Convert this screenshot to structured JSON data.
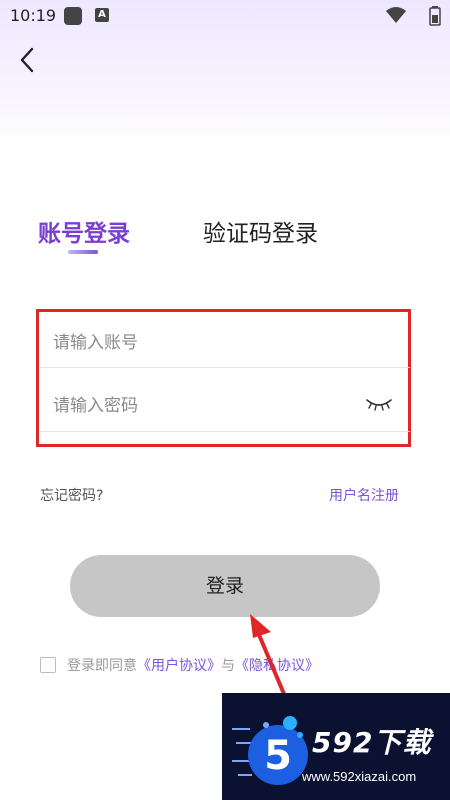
{
  "status_bar": {
    "time": "10:19",
    "icons": [
      "app-icon",
      "font-app-icon",
      "wifi-icon",
      "battery-icon"
    ]
  },
  "nav": {
    "back_icon": "chevron-left-icon"
  },
  "tabs": [
    {
      "label": "账号登录",
      "active": true
    },
    {
      "label": "验证码登录",
      "active": false
    }
  ],
  "form": {
    "account_placeholder": "请输入账号",
    "account_value": "",
    "password_placeholder": "请输入密码",
    "password_value": "",
    "password_toggle_icon": "eye-closed-icon"
  },
  "links": {
    "forgot_password": "忘记密码?",
    "register": "用户名注册"
  },
  "login_button": {
    "label": "登录"
  },
  "agreement": {
    "checked": false,
    "prefix": "登录即同意",
    "user_agreement": "《用户协议》",
    "connector": "与",
    "privacy_policy": "《隐私协议》"
  },
  "watermark": {
    "logo_digit": "5",
    "title": "592下载",
    "url": "www.592xiazai.com"
  },
  "colors": {
    "accent": "#7a55d8",
    "active_tab": "#7a3fd0",
    "highlight": "#e02626",
    "button_bg": "#c6c6c6"
  }
}
